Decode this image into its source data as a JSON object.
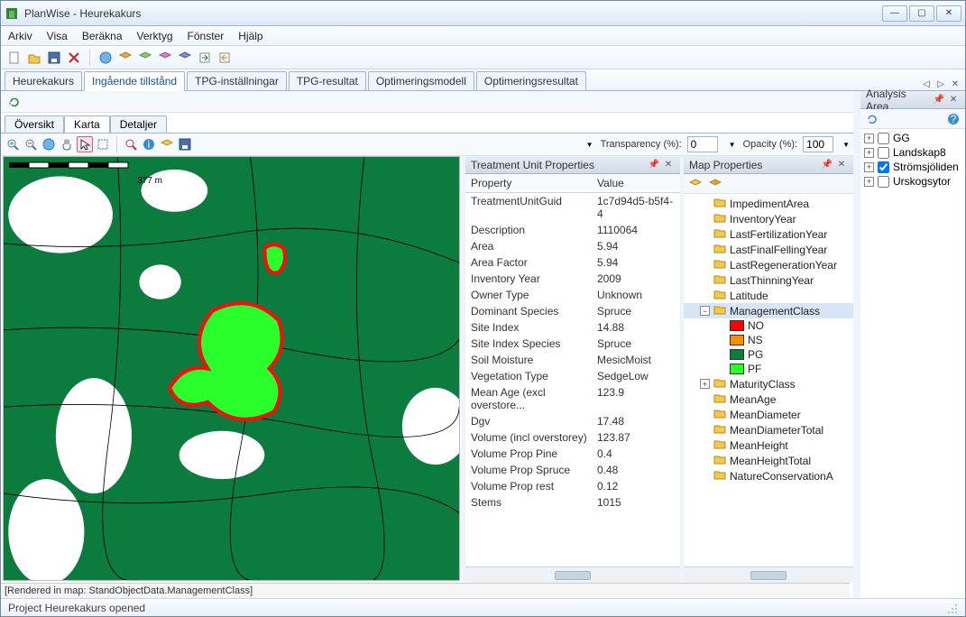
{
  "window": {
    "title": "PlanWise - Heurekakurs"
  },
  "menu": {
    "items": [
      "Arkiv",
      "Visa",
      "Beräkna",
      "Verktyg",
      "Fönster",
      "Hjälp"
    ]
  },
  "main_tabs": {
    "items": [
      "Heurekakurs",
      "Ingående tillstånd",
      "TPG-inställningar",
      "TPG-resultat",
      "Optimeringsmodell",
      "Optimeringsresultat"
    ],
    "active": 1
  },
  "sub_tabs": {
    "items": [
      "Översikt",
      "Karta",
      "Detaljer"
    ],
    "active": 1
  },
  "map_toolbar": {
    "transparency_label": "Transparency (%):",
    "transparency_value": "0",
    "opacity_label": "Opacity (%):",
    "opacity_value": "100",
    "scale_text": "377 m"
  },
  "rendered_text": "[Rendered in map: StandObjectData.ManagementClass]",
  "properties_panel": {
    "title": "Treatment Unit Properties",
    "col_property": "Property",
    "col_value": "Value",
    "rows": [
      {
        "k": "TreatmentUnitGuid",
        "v": "1c7d94d5-b5f4-4"
      },
      {
        "k": "Description",
        "v": "1110064"
      },
      {
        "k": "Area",
        "v": "5.94"
      },
      {
        "k": "Area Factor",
        "v": "5.94"
      },
      {
        "k": "Inventory Year",
        "v": "2009"
      },
      {
        "k": "Owner Type",
        "v": "Unknown"
      },
      {
        "k": "Dominant Species",
        "v": "Spruce"
      },
      {
        "k": "Site Index",
        "v": "14.88"
      },
      {
        "k": "Site Index Species",
        "v": "Spruce"
      },
      {
        "k": "Soil Moisture",
        "v": "MesicMoist"
      },
      {
        "k": "Vegetation Type",
        "v": "SedgeLow"
      },
      {
        "k": "Mean Age (excl overstore...",
        "v": "123.9"
      },
      {
        "k": "Dgv",
        "v": "17.48"
      },
      {
        "k": "Volume (incl overstorey)",
        "v": "123.87"
      },
      {
        "k": "Volume Prop Pine",
        "v": "0.4"
      },
      {
        "k": "Volume Prop Spruce",
        "v": "0.48"
      },
      {
        "k": "Volume Prop rest",
        "v": "0.12"
      },
      {
        "k": "Stems",
        "v": "1015"
      }
    ]
  },
  "map_props_panel": {
    "title": "Map Properties",
    "nodes": [
      {
        "type": "leaf",
        "label": "ImpedimentArea",
        "indent": 1
      },
      {
        "type": "leaf",
        "label": "InventoryYear",
        "indent": 1
      },
      {
        "type": "leaf",
        "label": "LastFertilizationYear",
        "indent": 1
      },
      {
        "type": "leaf",
        "label": "LastFinalFellingYear",
        "indent": 1
      },
      {
        "type": "leaf",
        "label": "LastRegenerationYear",
        "indent": 1
      },
      {
        "type": "leaf",
        "label": "LastThinningYear",
        "indent": 1
      },
      {
        "type": "leaf",
        "label": "Latitude",
        "indent": 1
      },
      {
        "type": "expandable",
        "label": "ManagementClass",
        "indent": 1,
        "open": true,
        "selected": true
      },
      {
        "type": "swatch",
        "label": "NO",
        "color": "#ff0000",
        "indent": 2
      },
      {
        "type": "swatch",
        "label": "NS",
        "color": "#ff8c00",
        "indent": 2
      },
      {
        "type": "swatch",
        "label": "PG",
        "color": "#0b7b3e",
        "indent": 2
      },
      {
        "type": "swatch",
        "label": "PF",
        "color": "#2bff2b",
        "indent": 2
      },
      {
        "type": "expandable",
        "label": "MaturityClass",
        "indent": 1,
        "open": false
      },
      {
        "type": "leaf",
        "label": "MeanAge",
        "indent": 1
      },
      {
        "type": "leaf",
        "label": "MeanDiameter",
        "indent": 1
      },
      {
        "type": "leaf",
        "label": "MeanDiameterTotal",
        "indent": 1
      },
      {
        "type": "leaf",
        "label": "MeanHeight",
        "indent": 1
      },
      {
        "type": "leaf",
        "label": "MeanHeightTotal",
        "indent": 1
      },
      {
        "type": "leaf",
        "label": "NatureConservationA",
        "indent": 1
      }
    ]
  },
  "analysis_panel": {
    "title": "Analysis Area",
    "items": [
      {
        "label": "GG",
        "checked": false
      },
      {
        "label": "Landskap8",
        "checked": false
      },
      {
        "label": "Strömsjöliden",
        "checked": true
      },
      {
        "label": "Urskogsytor",
        "checked": false
      }
    ]
  },
  "statusbar": {
    "text": "Project Heurekakurs opened"
  }
}
